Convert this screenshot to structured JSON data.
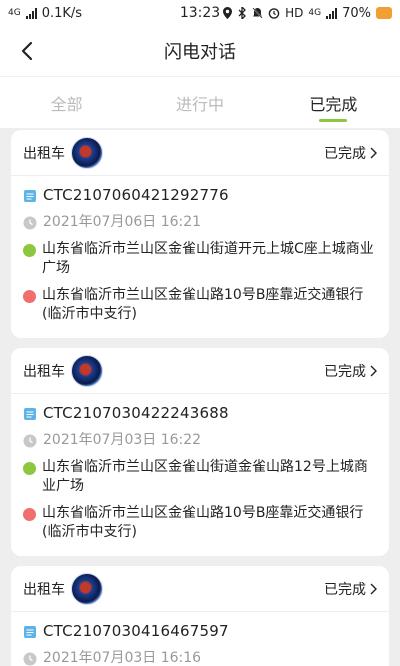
{
  "status_bar": {
    "network": "4G",
    "speed": "0.1K/s",
    "time": "13:23",
    "hd": "HD",
    "network2": "4G",
    "battery": "70%"
  },
  "header": {
    "title": "闪电对话"
  },
  "tabs": [
    {
      "label": "全部",
      "active": false
    },
    {
      "label": "进行中",
      "active": false
    },
    {
      "label": "已完成",
      "active": true
    }
  ],
  "colors": {
    "accent": "#8dc63f",
    "start_dot": "#8dc63f",
    "end_dot": "#f26d6d",
    "doc_icon": "#5bb3e8"
  },
  "orders": [
    {
      "type": "出租车",
      "status": "已完成",
      "order_no": "CTC2107060421292776",
      "datetime": "2021年07月06日 16:21",
      "from": "山东省临沂市兰山区金雀山街道开元上城C座上城商业广场",
      "to": "山东省临沂市兰山区金雀山路10号B座靠近交通银行(临沂市中支行)"
    },
    {
      "type": "出租车",
      "status": "已完成",
      "order_no": "CTC2107030422243688",
      "datetime": "2021年07月03日 16:22",
      "from": "山东省临沂市兰山区金雀山街道金雀山路12号上城商业广场",
      "to": "山东省临沂市兰山区金雀山路10号B座靠近交通银行(临沂市中支行)"
    },
    {
      "type": "出租车",
      "status": "已完成",
      "order_no": "CTC2107030416467597",
      "datetime": "2021年07月03日 16:16",
      "from": "",
      "to": ""
    }
  ]
}
